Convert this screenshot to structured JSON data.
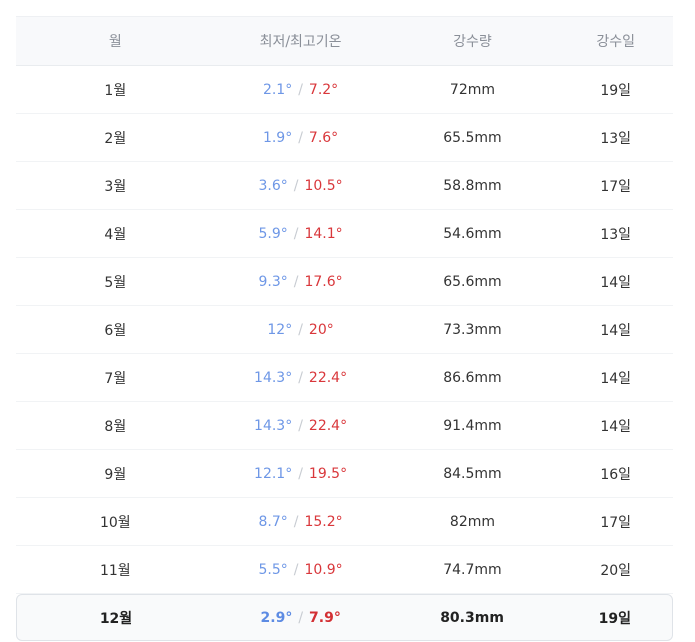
{
  "header": {
    "month": "월",
    "temp": "최저/최고기온",
    "precip": "강수량",
    "days": "강수일"
  },
  "colors": {
    "low_temp": "#6e97e6",
    "high_temp": "#d9373b",
    "header_bg": "#f8f9fb",
    "highlight_bg": "#f9fafb"
  },
  "separator": "/",
  "rows": [
    {
      "month": "1월",
      "low": "2.1°",
      "high": "7.2°",
      "precip": "72mm",
      "days": "19일"
    },
    {
      "month": "2월",
      "low": "1.9°",
      "high": "7.6°",
      "precip": "65.5mm",
      "days": "13일"
    },
    {
      "month": "3월",
      "low": "3.6°",
      "high": "10.5°",
      "precip": "58.8mm",
      "days": "17일"
    },
    {
      "month": "4월",
      "low": "5.9°",
      "high": "14.1°",
      "precip": "54.6mm",
      "days": "13일"
    },
    {
      "month": "5월",
      "low": "9.3°",
      "high": "17.6°",
      "precip": "65.6mm",
      "days": "14일"
    },
    {
      "month": "6월",
      "low": "12°",
      "high": "20°",
      "precip": "73.3mm",
      "days": "14일"
    },
    {
      "month": "7월",
      "low": "14.3°",
      "high": "22.4°",
      "precip": "86.6mm",
      "days": "14일"
    },
    {
      "month": "8월",
      "low": "14.3°",
      "high": "22.4°",
      "precip": "91.4mm",
      "days": "14일"
    },
    {
      "month": "9월",
      "low": "12.1°",
      "high": "19.5°",
      "precip": "84.5mm",
      "days": "16일"
    },
    {
      "month": "10월",
      "low": "8.7°",
      "high": "15.2°",
      "precip": "82mm",
      "days": "17일"
    },
    {
      "month": "11월",
      "low": "5.5°",
      "high": "10.9°",
      "precip": "74.7mm",
      "days": "20일"
    },
    {
      "month": "12월",
      "low": "2.9°",
      "high": "7.9°",
      "precip": "80.3mm",
      "days": "19일"
    }
  ]
}
